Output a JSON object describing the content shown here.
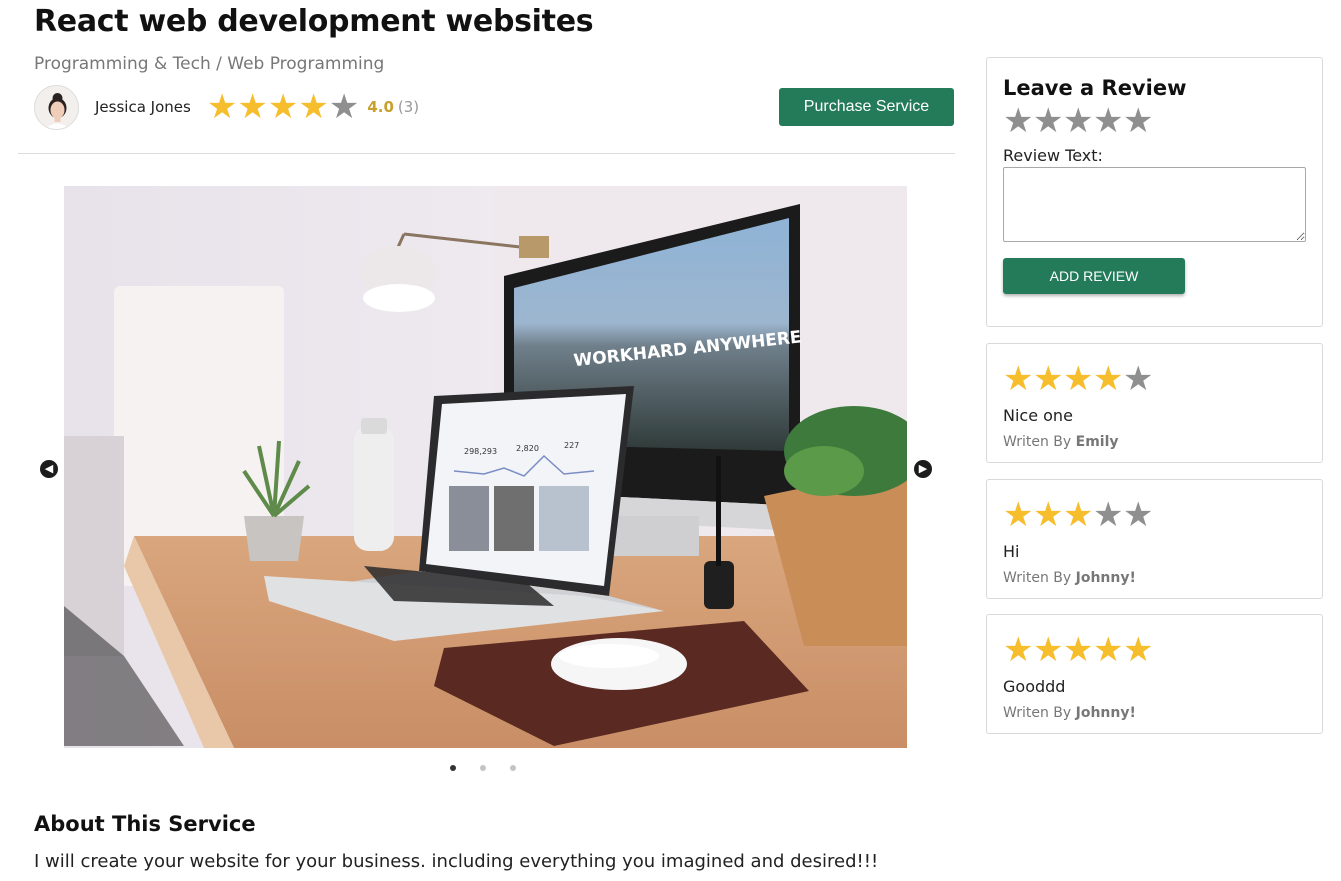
{
  "service": {
    "title": "React web development websites",
    "breadcrumb": "Programming & Tech / Web Programming"
  },
  "seller": {
    "name": "Jessica Jones",
    "rating": 4,
    "rating_value": "4.0",
    "rating_count": "(3)"
  },
  "purchase_label": "Purchase Service",
  "carousel": {
    "image_caption": "WORKHARD ANYWHERE",
    "laptop_stats": [
      "298,293",
      "2,820",
      "227"
    ],
    "slide_count": 3,
    "active_slide": 1
  },
  "about": {
    "heading": "About This Service",
    "text": "I will create your website for your business. including everything you imagined and desired!!!"
  },
  "review_form": {
    "title": "Leave a Review",
    "rating": 0,
    "text_label": "Review Text:",
    "text_value": "",
    "submit_label": "ADD REVIEW"
  },
  "reviews": [
    {
      "rating": 4,
      "text": "Nice one",
      "author_prefix": "Writen By",
      "author": "Emily"
    },
    {
      "rating": 3,
      "text": "Hi",
      "author_prefix": "Writen By",
      "author": "Johnny!"
    },
    {
      "rating": 5,
      "text": "Gooddd",
      "author_prefix": "Writen By",
      "author": "Johnny!"
    }
  ],
  "colors": {
    "accent": "#237b5a",
    "star_filled": "#f6bd2c",
    "star_empty": "#8f8f8f"
  }
}
